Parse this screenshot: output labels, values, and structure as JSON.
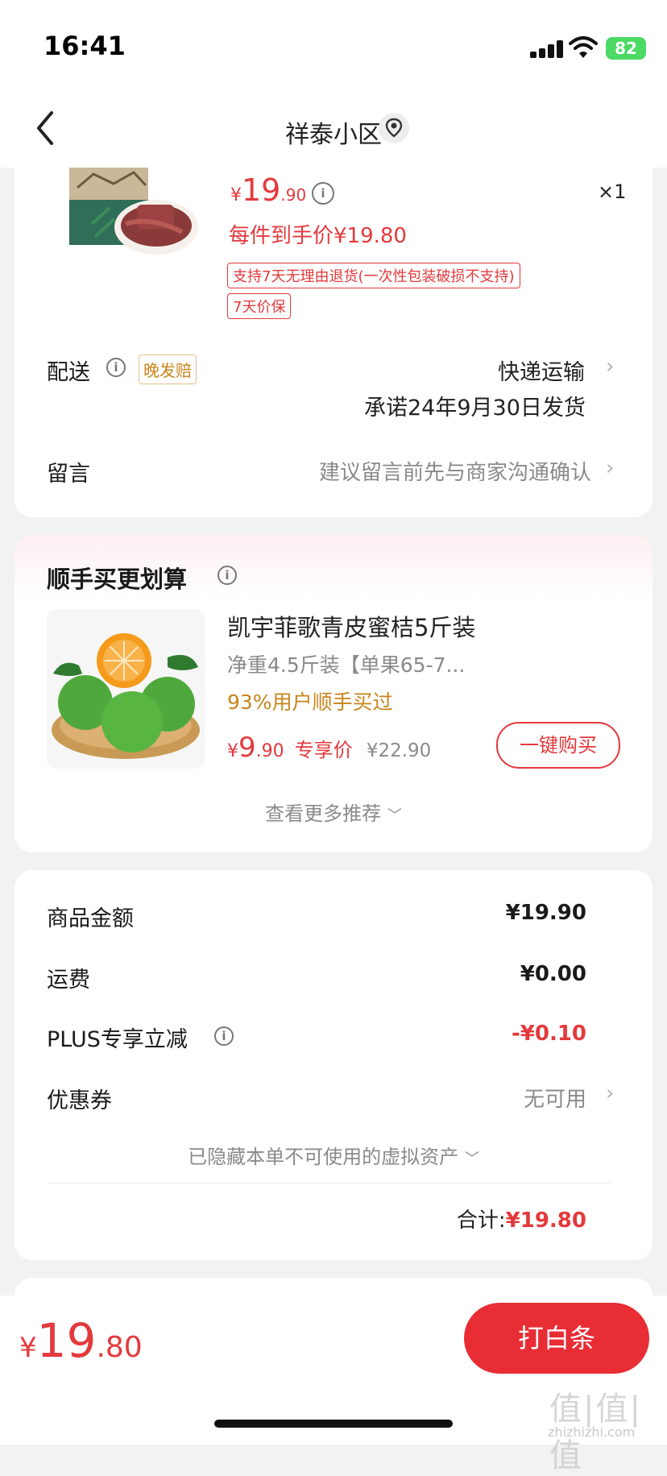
{
  "status": {
    "time": "16:41",
    "battery": "82"
  },
  "nav": {
    "title": "祥泰小区"
  },
  "product": {
    "price_symbol": "¥",
    "price_int": "19",
    "price_dec": ".90",
    "quantity": "×1",
    "final_price": "每件到手价¥19.80",
    "tags": [
      "支持7天无理由退货(一次性包装破损不支持)",
      "7天价保"
    ]
  },
  "delivery": {
    "label": "配送",
    "badge": "晚发赔",
    "method": "快递运输",
    "promise": "承诺24年9月30日发货"
  },
  "message": {
    "label": "留言",
    "placeholder": "建议留言前先与商家沟通确认"
  },
  "recommend": {
    "title": "顺手买更划算",
    "item": {
      "name": "凯宇菲歌青皮蜜桔5斤装",
      "spec": "净重4.5斤装【单果65-7...",
      "social": "93%用户顺手买过",
      "price_symbol": "¥",
      "price_int": "9",
      "price_dec": ".90",
      "price_label": "专享价",
      "original_price": "¥22.90",
      "buy_label": "一键购买"
    },
    "more_label": "查看更多推荐"
  },
  "summary": {
    "rows": [
      {
        "label": "商品金额",
        "value": "¥19.90"
      },
      {
        "label": "运费",
        "value": "¥0.00"
      },
      {
        "label": "PLUS专享立减",
        "value": "-¥0.10"
      },
      {
        "label": "优惠券",
        "value": "无可用"
      }
    ],
    "hidden_assets": "已隐藏本单不可使用的虚拟资产",
    "total_label": "合计:",
    "total_value": "¥19.80"
  },
  "bottom": {
    "price_symbol": "¥",
    "price_int": "19",
    "price_dec": ".80",
    "pay_label": "打白条"
  },
  "watermark": {
    "logo": "值|值|值",
    "url": "zhizhizhi.com"
  },
  "colors": {
    "accent": "#e4393c",
    "orange": "#c8841a",
    "battery": "#4cd964"
  }
}
